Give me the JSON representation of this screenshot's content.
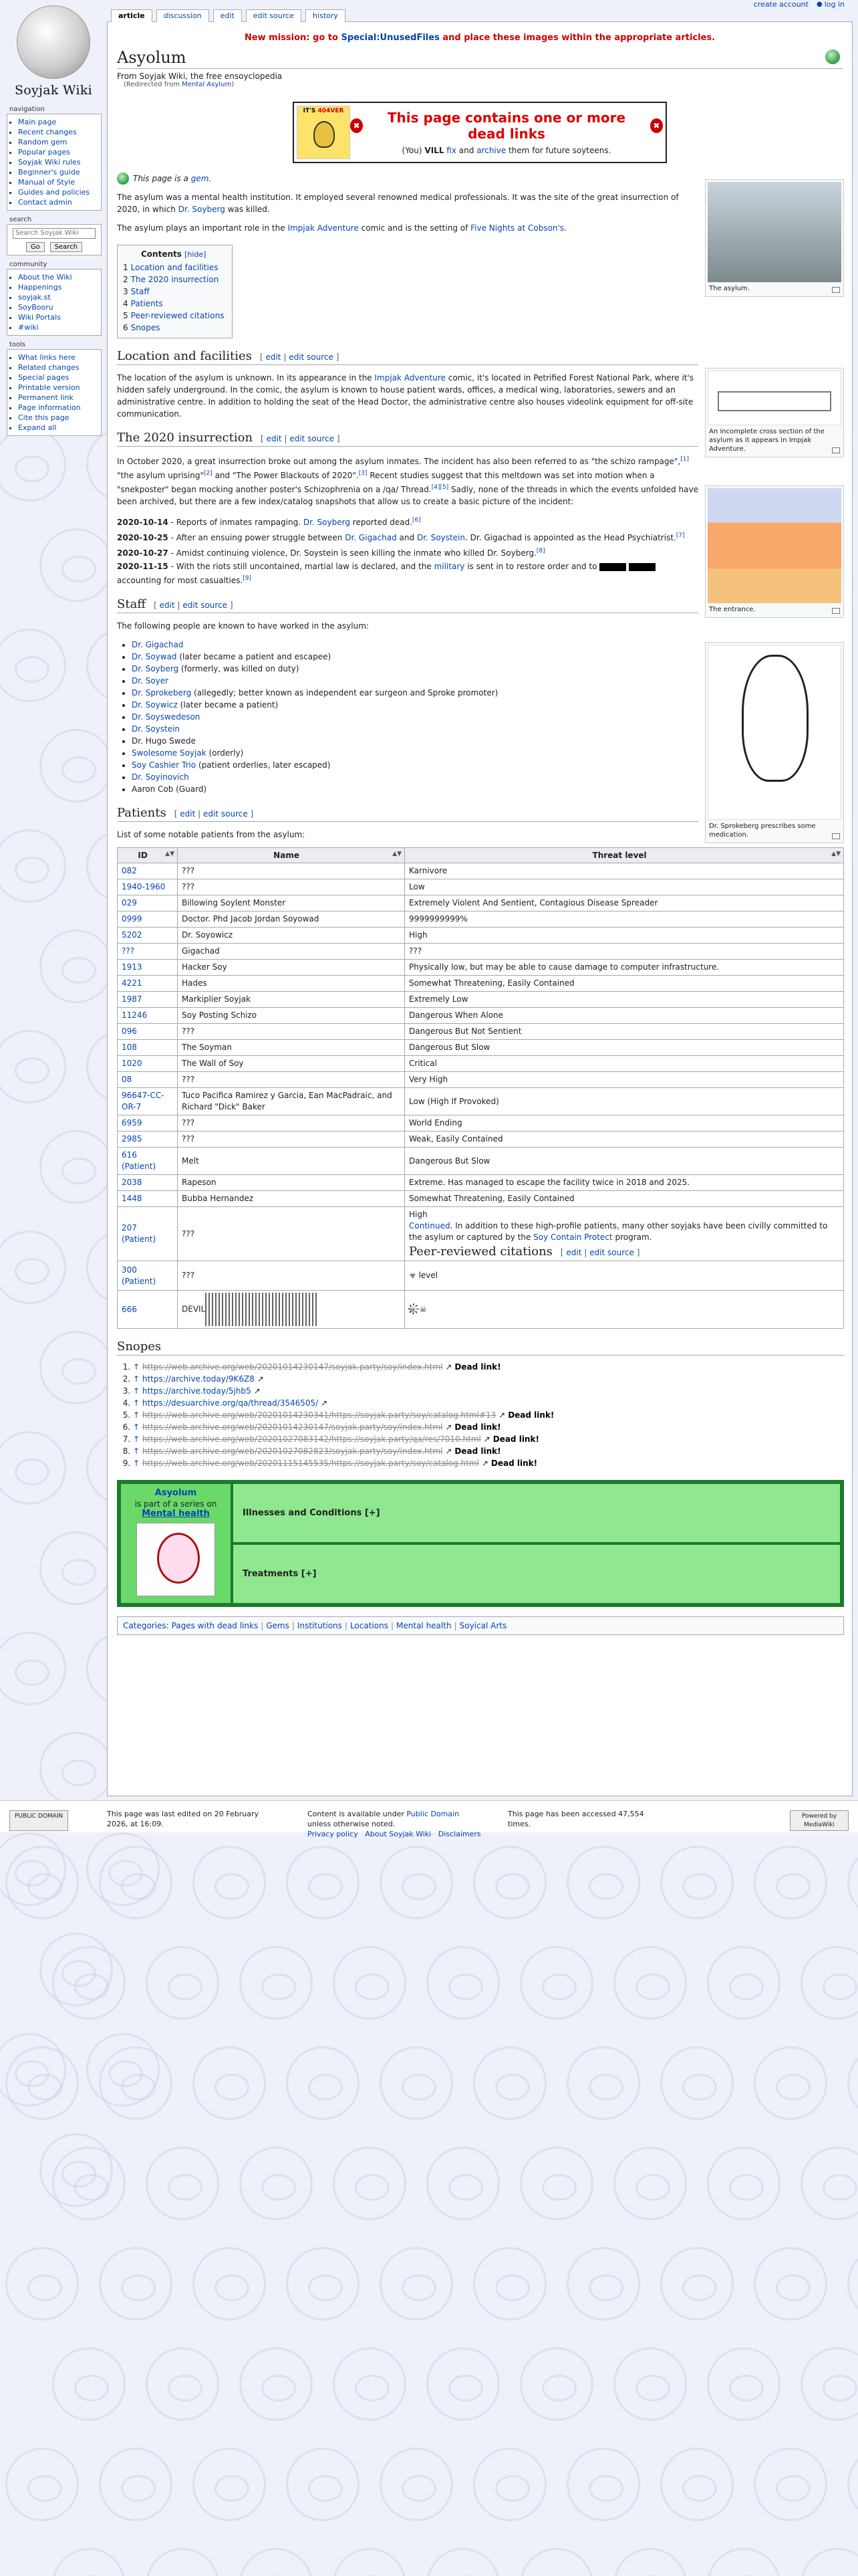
{
  "logo": {
    "wordmark": "Soyjak Wiki"
  },
  "personal": {
    "account": "create account",
    "login": "log in"
  },
  "tabs": [
    {
      "label": "article",
      "active": true
    },
    {
      "label": "discussion",
      "active": false
    },
    {
      "label": "edit",
      "active": false
    },
    {
      "label": "edit source",
      "active": false
    },
    {
      "label": "history",
      "active": false
    }
  ],
  "sitenotice": {
    "prefix": "New mission: go to",
    "link": "Special:UnusedFiles",
    "suffix": "and place these images within the appropriate articles."
  },
  "page": {
    "title": "Asyolum",
    "tagline": "From Soyjak Wiki, the free ensoyclopedia",
    "redirect_prefix": "(Redirected from",
    "redirect_link": "Mental Asylum",
    "redirect_suffix": ")"
  },
  "deadbox": {
    "image_caption_a": "IT'S",
    "image_caption_b": "404VER",
    "heading": "This page contains one or more dead links",
    "line_pre": "(You)",
    "vill": "VILL",
    "fix": "fix",
    "and": "and",
    "archive": "archive",
    "line_post": "them for future soyteens."
  },
  "gem": {
    "pre": "This page is a",
    "link": "gem",
    "post": "."
  },
  "intro": {
    "p1a": "The asylum was a mental health institution. It employed several renowned medical professionals. It was the site of the great insurrection of 2020, in which",
    "p1link": "Dr. Soyberg",
    "p1b": "was killed.",
    "p2a": "The asylum plays an important role in the",
    "p2link1": "Impjak Adventure",
    "p2b": "comic and is the setting of",
    "p2link2": "Five Nights at Cobson's",
    "p2c": "."
  },
  "toc": {
    "title": "Contents",
    "hide": "[hide]",
    "items": [
      {
        "num": "1",
        "label": "Location and facilities"
      },
      {
        "num": "2",
        "label": "The 2020 insurrection"
      },
      {
        "num": "3",
        "label": "Staff"
      },
      {
        "num": "4",
        "label": "Patients"
      },
      {
        "num": "5",
        "label": "Peer-reviewed citations"
      },
      {
        "num": "6",
        "label": "Snopes"
      }
    ]
  },
  "edit_section": {
    "lb": "[",
    "edit": "edit",
    "bar": "|",
    "editsrc": "edit source",
    "rb": "]"
  },
  "location": {
    "heading": "Location and facilities",
    "text_a": "The location of the asylum is unknown. In its appearance in the",
    "link": "Impjak Adventure",
    "text_b": "comic, it's located in Petrified Forest National Park, where it's hidden safely underground. In the comic, the asylum is known to house patient wards, offices, a medical wing, laboratories, sewers and an administrative centre. In addition to holding the seat of the Head Doctor, the administrative centre also houses videolink equipment for off-site communication."
  },
  "insurrection": {
    "heading": "The 2020 insurrection",
    "text_a": "In October 2020, a great insurrection broke out among the asylum inmates. The incident has also been referred to as \"the schizo rampage\",",
    "ref1": "[1]",
    "text_b": "\"the asylum uprising\"",
    "ref2": "[2]",
    "text_c": "and \"The Power Blackouts of 2020\".",
    "ref3": "[3]",
    "text_d": "Recent studies suggest that this meltdown was set into motion when a \"snekposter\" began mocking another poster's Schizophrenia on a /qa/ Thread.",
    "ref45": "[4][5]",
    "text_e": "Sadly, none of the threads in which the events unfolded have been archived, but there are a few index/catalog snapshots that allow us to create a basic picture of the incident:",
    "events": [
      {
        "date": "2020-10-14",
        "text_a": " - Reports of inmates rampaging.",
        "link": "Dr. Soyberg",
        "text_b": "reported dead.",
        "ref": "[6]"
      },
      {
        "date": "2020-10-25",
        "text_a": " - After an ensuing power struggle between",
        "link": "Dr. Gigachad",
        "mid": "and",
        "link2": "Dr. Soystein",
        "text_b": ". Dr. Gigachad is appointed as the Head Psychiatrist.",
        "ref": "[7]"
      },
      {
        "date": "2020-10-27",
        "text_a": " - Amidst continuing violence, Dr. Soystein is seen killing the inmate who killed Dr. Soyberg.",
        "ref": "[8]"
      },
      {
        "date": "2020-11-15",
        "text_a": " - With the riots still uncontained, martial law is declared, and the",
        "link": "military",
        "text_b": "is sent in to restore order and to",
        "text_c": "accounting for most casualties.",
        "ref": "[9]"
      }
    ]
  },
  "staff": {
    "heading": "Staff",
    "intro": "The following people are known to have worked in the asylum:",
    "items": [
      {
        "link": "Dr. Gigachad",
        "note": ""
      },
      {
        "link": "Dr. Soywad",
        "note": "(later became a patient and escapee)"
      },
      {
        "link": "Dr. Soyberg",
        "note": "(formerly, was killed on duty)"
      },
      {
        "link": "Dr. Soyer",
        "note": ""
      },
      {
        "link": "Dr. Sprokeberg",
        "note": "(allegedly; better known as independent ear surgeon and Sproke promoter)"
      },
      {
        "link": "Dr. Soywicz",
        "note": "(later became a patient)"
      },
      {
        "link": "Dr. Soyswedeson",
        "note": ""
      },
      {
        "link": "Dr. Soystein",
        "note": ""
      },
      {
        "link": "",
        "note": "Dr. Hugo Swede"
      },
      {
        "link": "Swolesome Soyjak",
        "note": "(orderly)"
      },
      {
        "link": "Soy Cashier Trio",
        "note": "(patient orderlies, later escaped)"
      },
      {
        "link": "Dr. Soyinovich",
        "note": ""
      },
      {
        "link": "",
        "note": "Aaron Cob (Guard)"
      }
    ]
  },
  "patients": {
    "heading": "Patients",
    "intro": "List of some notable patients from the asylum:",
    "columns": [
      "ID",
      "Name",
      "Threat level"
    ],
    "rows": [
      {
        "id": "082",
        "name": "???",
        "threat": "Karnivore"
      },
      {
        "id": "1940-1960",
        "name": "???",
        "threat": "Low"
      },
      {
        "id": "029",
        "name": "Billowing Soylent Monster",
        "threat": "Extremely Violent And Sentient, Contagious Disease Spreader"
      },
      {
        "id": "0999",
        "name": "Doctor. Phd Jacob Jordan Soyowad",
        "threat": "9999999999%"
      },
      {
        "id": "5202",
        "name": "Dr. Soyowicz",
        "threat": "High"
      },
      {
        "id": "???",
        "name": "Gigachad",
        "threat": "???"
      },
      {
        "id": "1913",
        "name": "Hacker Soy",
        "threat": "Physically low, but may be able to cause damage to computer infrastructure."
      },
      {
        "id": "4221",
        "name": "Hades",
        "threat": "Somewhat Threatening, Easily Contained"
      },
      {
        "id": "1987",
        "name": "Markiplier Soyjak",
        "threat": "Extremely Low"
      },
      {
        "id": "11246",
        "name": "Soy Posting Schizo",
        "threat": "Dangerous When Alone"
      },
      {
        "id": "096",
        "name": "???",
        "threat": "Dangerous But Not Sentient"
      },
      {
        "id": "108",
        "name": "The Soyman",
        "threat": "Dangerous But Slow"
      },
      {
        "id": "1020",
        "name": "The Wall of Soy",
        "threat": "Critical"
      },
      {
        "id": "08",
        "name": "???",
        "threat": "Very High"
      },
      {
        "id": "96647-CC-OR-7",
        "name": "Tuco Pacifica Ramirez y Garcia, Ean MacPadraic, and Richard \"Dick\" Baker",
        "threat": "Low (High If Provoked)"
      },
      {
        "id": "6959",
        "name": "???",
        "threat": "World Ending"
      },
      {
        "id": "2985",
        "name": "???",
        "threat": "Weak, Easily Contained"
      },
      {
        "id": "616 (Patient)",
        "name": "Melt",
        "threat": "Dangerous But Slow"
      },
      {
        "id": "2038",
        "name": "Rapeson",
        "threat": "Extreme. Has managed to escape the facility twice in 2018 and 2025."
      },
      {
        "id": "1448",
        "name": "Bubba Hernandez",
        "threat": "Somewhat Threatening, Easily Contained"
      }
    ],
    "row207": {
      "id": "207 (Patient)",
      "name": "???",
      "threat_a": "High",
      "continued": "Continued",
      "threat_b": ". In addition to these high-profile patients, many other soyjaks have been civilly committed to the asylum or captured by the",
      "link": "Soy Contain Protect",
      "threat_c": "program."
    },
    "row300": {
      "id": "300 (Patient)",
      "name": "???",
      "threat": "☣ level"
    },
    "row666": {
      "id": "666",
      "name": "DEVIL",
      "threat": "☠҉☠"
    }
  },
  "citations": {
    "heading": "Peer-reviewed citations"
  },
  "snopes": {
    "heading": "Snopes",
    "dead_label": "Dead link!",
    "refs": [
      {
        "url": "https://web.archive.org/web/20201014230147/soyjak.party/soy/index.html",
        "dead": true
      },
      {
        "url": "https://archive.today/9K6Z8",
        "dead": false
      },
      {
        "url": "https://archive.today/5jhb5",
        "dead": false
      },
      {
        "url": "https://desuarchive.org/qa/thread/3546505/",
        "dead": false
      },
      {
        "url": "https://web.archive.org/web/20201014230341/https://soyjak.party/soy/catalog.html#13",
        "dead": true
      },
      {
        "url": "https://web.archive.org/web/20201014230147/soyjak.party/soy/index.html",
        "dead": true
      },
      {
        "url": "https://web.archive.org/web/20201027083142/https://soyjak.party/qa/res/7010.html",
        "dead": true
      },
      {
        "url": "https://web.archive.org/web/20201027082823/soyjak.party/soy/index.html",
        "dead": true
      },
      {
        "url": "https://web.archive.org/web/20201115145535/https://soyjak.party/soy/catalog.html",
        "dead": true
      }
    ]
  },
  "navbox": {
    "title": "Asyolum",
    "is_part": "is part of a series on",
    "series": "Mental health",
    "row1": "Illnesses and Conditions [+]",
    "row2": "Treatments [+]"
  },
  "categories": {
    "label": "Categories",
    "items": [
      "Pages with dead links",
      "Gems",
      "Institutions",
      "Locations",
      "Mental health",
      "Soyical Arts"
    ]
  },
  "thumbs": [
    {
      "caption": "The asylum."
    },
    {
      "caption": "An incomplete cross section of the asylum as it appears in Impjak Adventure."
    },
    {
      "caption": "The entrance."
    },
    {
      "caption": "Dr. Sprokeberg prescribes some medication."
    }
  ],
  "footer": {
    "pd": "PUBLIC DOMAIN",
    "edited": "This page was last edited on 20 February 2026, at 16:09.",
    "license_pre": "Content is available under",
    "license_link": "Public Domain",
    "license_post": "unless otherwise noted.",
    "privacy": "Privacy policy",
    "about": "About Soyjak Wiki",
    "disclaimers": "Disclaimers",
    "accessed": "This page has been accessed 47,554 times.",
    "mw": "Powered by MediaWiki"
  },
  "sidebar": {
    "navigation": {
      "title": "navigation",
      "items": [
        "Main page",
        "Recent changes",
        "Random gem",
        "Popular pages",
        "Soyjak Wiki rules",
        "Beginner's guide",
        "Manual of Style",
        "Guides and policies",
        "Contact admin"
      ]
    },
    "search": {
      "title": "search",
      "placeholder": "Search Soyjak Wiki",
      "go": "Go",
      "search": "Search"
    },
    "community": {
      "title": "community",
      "items": [
        "About the Wiki",
        "Happenings",
        "soyjak.st",
        "SoyBooru",
        "Wiki Portals",
        "#wiki"
      ]
    },
    "tools": {
      "title": "tools",
      "items": [
        "What links here",
        "Related changes",
        "Special pages",
        "Printable version",
        "Permanent link",
        "Page information",
        "Cite this page",
        "Expand all"
      ]
    }
  }
}
